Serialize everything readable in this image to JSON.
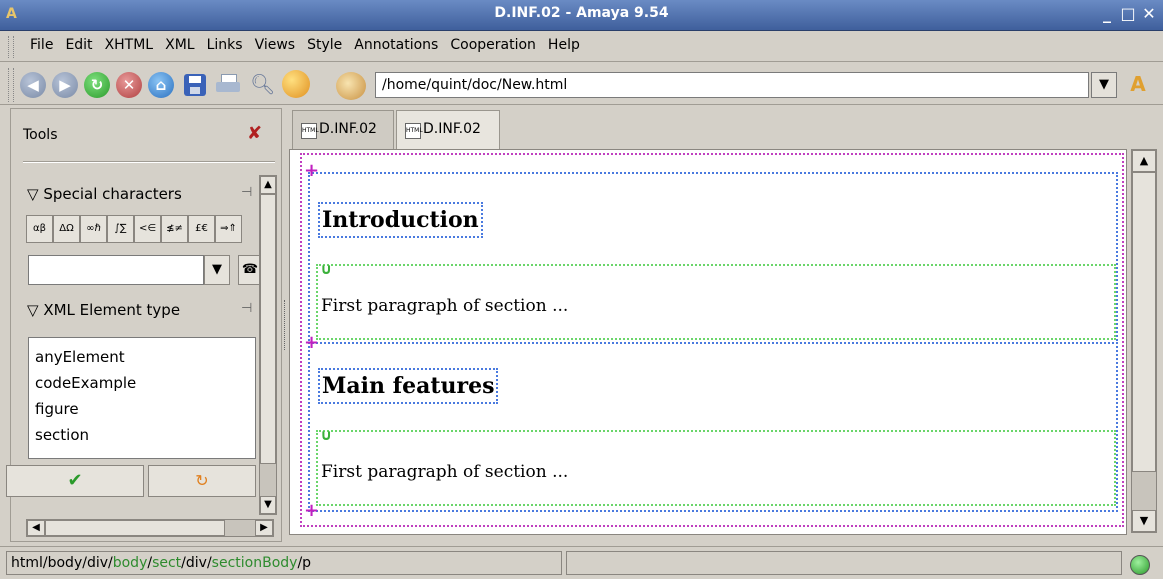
{
  "window": {
    "title": "D.INF.02 - Amaya 9.54",
    "minimize_glyph": "_",
    "maximize_glyph": "□",
    "close_glyph": "✕"
  },
  "menubar": {
    "items": [
      "File",
      "Edit",
      "XHTML",
      "XML",
      "Links",
      "Views",
      "Style",
      "Annotations",
      "Cooperation",
      "Help"
    ]
  },
  "toolbar": {
    "url": "/home/quint/doc/New.html",
    "icons": [
      "back-icon",
      "forward-icon",
      "reload-icon",
      "stop-icon",
      "home-icon",
      "save-icon",
      "print-icon",
      "find-icon",
      "spellcheck-icon"
    ]
  },
  "tools": {
    "title": "Tools",
    "close_glyph": "✘",
    "special_characters": {
      "label": "Special characters",
      "palette": [
        "αβ",
        "ΔΩ",
        "∞ℏ",
        "∫∑",
        "<∈",
        "≰≠",
        "£€",
        "⇒⇑"
      ]
    },
    "xml_element_type": {
      "label": "XML Element type",
      "items": [
        "anyElement",
        "codeExample",
        "figure",
        "section"
      ]
    }
  },
  "tabs": [
    {
      "label": "D.INF.02",
      "icon": "html-file-icon",
      "active": false
    },
    {
      "label": "D.INF.02",
      "icon": "html-file-icon",
      "active": true
    }
  ],
  "document": {
    "sections": [
      {
        "heading": "Introduction",
        "paragraph": "First paragraph of section ..."
      },
      {
        "heading": "Main features",
        "paragraph": "First paragraph of section ..."
      }
    ]
  },
  "status": {
    "path": [
      {
        "text": "html",
        "color": "#000000"
      },
      {
        "text": "/",
        "color": "#000000"
      },
      {
        "text": "body",
        "color": "#000000"
      },
      {
        "text": "/",
        "color": "#000000"
      },
      {
        "text": "div",
        "color": "#000000"
      },
      {
        "text": "/",
        "color": "#000000"
      },
      {
        "text": "body",
        "color": "#2e8b2e"
      },
      {
        "text": "/",
        "color": "#000000"
      },
      {
        "text": "sect",
        "color": "#2e8b2e"
      },
      {
        "text": "/",
        "color": "#000000"
      },
      {
        "text": "div",
        "color": "#000000"
      },
      {
        "text": "/",
        "color": "#000000"
      },
      {
        "text": "sectionBody",
        "color": "#2e8b2e"
      },
      {
        "text": "/",
        "color": "#000000"
      },
      {
        "text": "p",
        "color": "#000000"
      }
    ],
    "indicator_color": "#3aaa3a"
  },
  "colors": {
    "title_bar": "#4a6aa8",
    "section_border": "#c040c0",
    "heading_border": "#4a7adf",
    "paragraph_border": "#6ad66a"
  }
}
